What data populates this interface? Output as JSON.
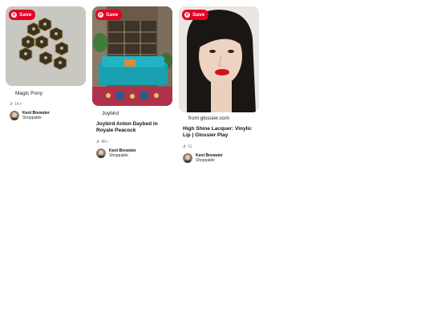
{
  "save_label": "Save",
  "pins": [
    {
      "source": "Magic Pony",
      "title": "",
      "stat": "1K+",
      "author": {
        "name": "Kent Brewster",
        "sub": "Shoppable"
      }
    },
    {
      "source": "Joybird",
      "title": "Joybird Anton Daybed in Royale Peacock",
      "stat": "4K+",
      "author": {
        "name": "Kent Brewster",
        "sub": "Shoppable"
      }
    },
    {
      "source": "from glossier.com",
      "title": "High Shine Lacquer: Vinylic Lip | Glossier Play",
      "stat": "11",
      "author": {
        "name": "Kent Brewster",
        "sub": "Shoppable"
      }
    }
  ],
  "colors": {
    "save_red": "#e60023",
    "muted": "#767676"
  },
  "icons": [
    "pinterest-p-icon",
    "pin-stat-icon"
  ]
}
